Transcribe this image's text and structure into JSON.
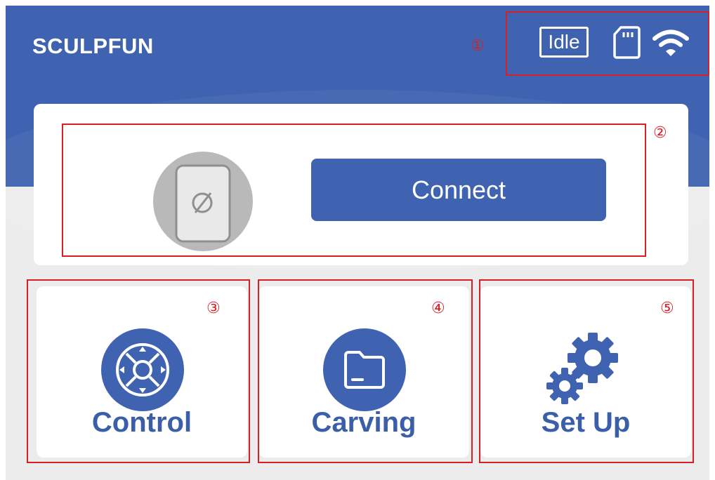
{
  "header": {
    "title": "SCULPFUN",
    "status": {
      "idle_label": "Idle",
      "sd_icon": "sd-card-icon",
      "wifi_icon": "wifi-icon"
    }
  },
  "connect": {
    "button_label": "Connect",
    "device_icon": "phone-disconnected-icon"
  },
  "tiles": [
    {
      "label": "Control",
      "icon": "joystick-icon"
    },
    {
      "label": "Carving",
      "icon": "folder-icon"
    },
    {
      "label": "Set Up",
      "icon": "gears-icon"
    }
  ],
  "annotations": [
    "①",
    "②",
    "③",
    "④",
    "⑤"
  ],
  "colors": {
    "primary": "#3f63b0",
    "label_blue": "#3b5ea9",
    "annotation_red": "#d81f26",
    "background": "#ececec"
  }
}
